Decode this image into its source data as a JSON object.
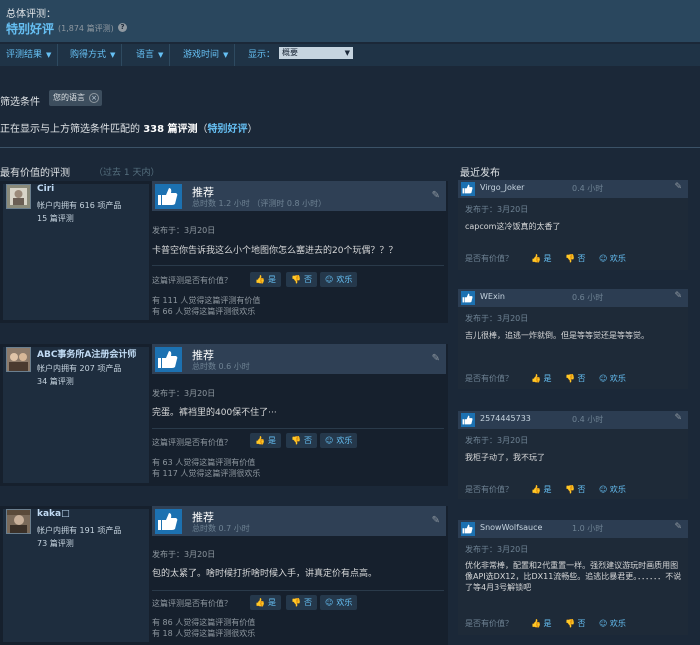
{
  "overall": {
    "label": "总体评测：",
    "rating": "特别好评",
    "count": "(1,874 篇评测)",
    "help": "?"
  },
  "filters": {
    "items": [
      "评测结果",
      "购得方式",
      "语言",
      "游戏时间"
    ],
    "display_label": "显示：",
    "display_value": "概要",
    "conditions_label": "筛选条件",
    "chip": "您的语言",
    "showing_pre": "正在显示与上方筛选条件匹配的",
    "showing_count": "338 篇评测",
    "showing_open": "（",
    "showing_rating": "特别好评",
    "showing_close": "）"
  },
  "helpful_section": {
    "title": "最有价值的评测",
    "note": "（过去 1 天内）"
  },
  "recent_section": {
    "title": "最近发布"
  },
  "reviews": [
    {
      "author": "Ciri",
      "products": "帐户内拥有 616 项产品",
      "count": "15 篇评测",
      "verdict": "推荐",
      "hours": "总时数 1.2 小时 （评测时 0.8 小时）",
      "posted": "发布于：3月20日",
      "text": "卡普空你告诉我这么小个地图你怎么塞进去的20个玩偶？？？",
      "question": "这篇评测是否有价值？",
      "yes": "是",
      "no": "否",
      "funny": "欢乐",
      "helpful": "有 111 人觉得这篇评测有价值",
      "funny_count": "有 66 人觉得这篇评测很欢乐"
    },
    {
      "author": "ABC事务所A注册会计师",
      "products": "帐户内拥有 207 项产品",
      "count": "34 篇评测",
      "verdict": "推荐",
      "hours": "总时数 0.6 小时",
      "posted": "发布于：3月20日",
      "text": "完蛋。裤裆里的400保不住了···",
      "question": "这篇评测是否有价值？",
      "yes": "是",
      "no": "否",
      "funny": "欢乐",
      "helpful": "有 63 人觉得这篇评测有价值",
      "funny_count": "有 117 人觉得这篇评测很欢乐"
    },
    {
      "author": "kaka□",
      "products": "帐户内拥有 191 项产品",
      "count": "73 篇评测",
      "verdict": "推荐",
      "hours": "总时数 0.7 小时",
      "posted": "发布于：3月20日",
      "text": "包的太紧了。啥时候打折啥时候入手，讲真定价有点高。",
      "question": "这篇评测是否有价值？",
      "yes": "是",
      "no": "否",
      "funny": "欢乐",
      "helpful": "有 86 人觉得这篇评测有价值",
      "funny_count": "有 18 人觉得这篇评测很欢乐"
    }
  ],
  "recent": [
    {
      "author": "Virgo_Joker",
      "hours": "0.4 小时",
      "posted": "发布于：3月20日",
      "text": "capcom这冷饭真的太香了",
      "question": "是否有价值？",
      "yes": "是",
      "no": "否",
      "funny": "欢乐"
    },
    {
      "author": "WExin",
      "hours": "0.6 小时",
      "posted": "发布于：3月20日",
      "text": "吉儿很棒，追逃一炸就倒。但是等等觉还是等等觉。",
      "question": "是否有价值？",
      "yes": "是",
      "no": "否",
      "funny": "欢乐"
    },
    {
      "author": "2574445733",
      "hours": "0.4 小时",
      "posted": "发布于：3月20日",
      "text": "我柜子动了，我不玩了",
      "question": "是否有价值？",
      "yes": "是",
      "no": "否",
      "funny": "欢乐"
    },
    {
      "author": "SnowWolfsauce",
      "hours": "1.0 小时",
      "posted": "发布于：3月20日",
      "text": "优化非常棒，配置和2代重置一样。强烈建议游玩时画质用图像API选DX12，比DX11流畅些。追逃比暴君更。．．．．．．不说了等4月3号解锁吧",
      "question": "是否有价值？",
      "yes": "是",
      "no": "否",
      "funny": "欢乐"
    }
  ]
}
